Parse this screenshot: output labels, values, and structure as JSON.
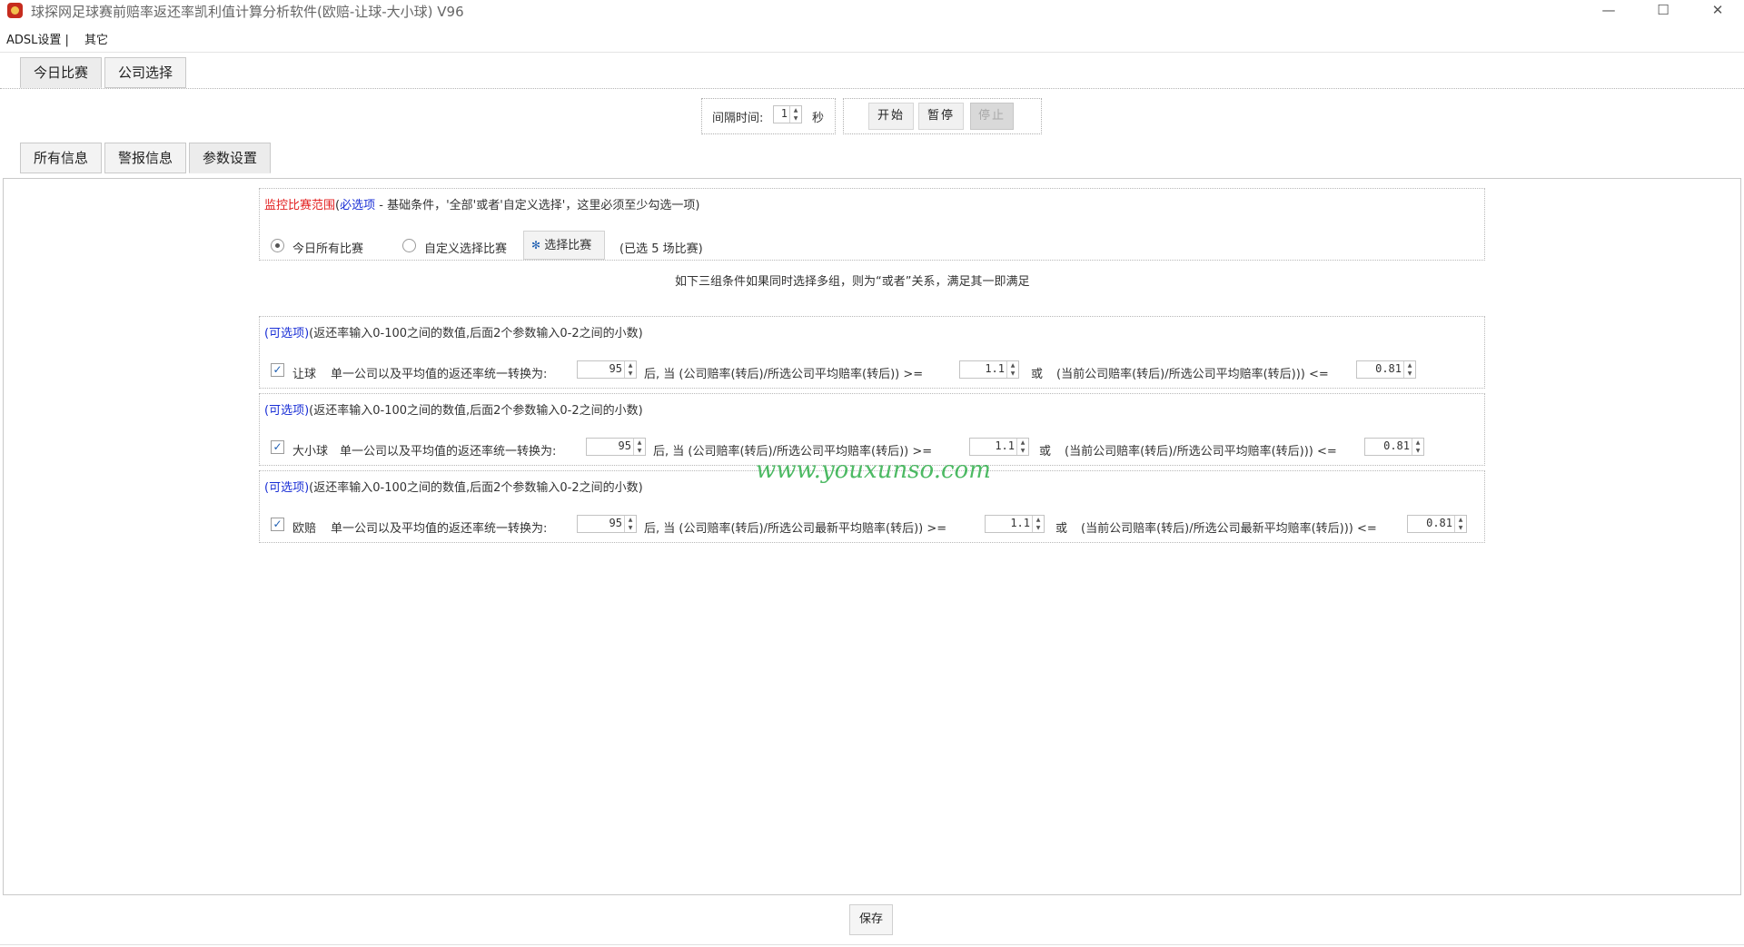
{
  "window": {
    "title": "球探网足球赛前赔率返还率凯利值计算分析软件(欧赔-让球-大小球) V96",
    "minimize": "—",
    "maximize": "☐",
    "close": "✕"
  },
  "menu": {
    "items": [
      "ADSL设置 |",
      "其它"
    ]
  },
  "top_tabs": [
    "今日比赛",
    "公司选择"
  ],
  "controls": {
    "interval_label": "间隔时间:",
    "interval_value": "1",
    "interval_unit": "秒",
    "start": "开始",
    "pause": "暂停",
    "stop": "停止"
  },
  "sub_tabs": [
    "所有信息",
    "警报信息",
    "参数设置"
  ],
  "range_section": {
    "title_red": "监控比赛范围",
    "title_paren_open": "(",
    "title_blue": "必选项",
    "title_rest": " - 基础条件，'全部'或者'自定义选择'，这里必须至少勾选一项)",
    "option_all": "今日所有比赛",
    "option_custom": "自定义选择比赛",
    "select_button": "选择比赛",
    "selected_info": "(已选 5 场比赛)"
  },
  "notice": "如下三组条件如果同时选择多组，则为“或者”关系，满足其一即满足",
  "condition_sections": [
    {
      "head_optional": "(可选项)",
      "head_desc": "(返还率输入0-100之间的数值,后面2个参数输入0-2之间的小数)",
      "checked": true,
      "name": "让球",
      "desc1": "单一公司以及平均值的返还率统一转换为:",
      "value1": "95",
      "desc2": "后, 当 (公司赔率(转后)/所选公司平均赔率(转后))  >=",
      "value2": "1.1",
      "or_label": "或",
      "desc3": "(当前公司赔率(转后)/所选公司平均赔率(转后))) <=",
      "value3": "0.81"
    },
    {
      "head_optional": "(可选项)",
      "head_desc": "(返还率输入0-100之间的数值,后面2个参数输入0-2之间的小数)",
      "checked": true,
      "name": "大小球",
      "desc1": "单一公司以及平均值的返还率统一转换为:",
      "value1": "95",
      "desc2": "后, 当 (公司赔率(转后)/所选公司平均赔率(转后))  >=",
      "value2": "1.1",
      "or_label": "或",
      "desc3": "(当前公司赔率(转后)/所选公司平均赔率(转后))) <=",
      "value3": "0.81"
    },
    {
      "head_optional": "(可选项)",
      "head_desc": "(返还率输入0-100之间的数值,后面2个参数输入0-2之间的小数)",
      "checked": true,
      "name": "欧赔",
      "desc1": "单一公司以及平均值的返还率统一转换为:",
      "value1": "95",
      "desc2": "后, 当 (公司赔率(转后)/所选公司最新平均赔率(转后))  >=",
      "value2": "1.1",
      "or_label": "或",
      "desc3": "(当前公司赔率(转后)/所选公司最新平均赔率(转后))) <=",
      "value3": "0.81"
    }
  ],
  "watermark": "www.youxunso.com",
  "save": "保存",
  "colors": {
    "red": "#e32020",
    "blue": "#1a2fd6",
    "watermark": "#2fae4a"
  }
}
